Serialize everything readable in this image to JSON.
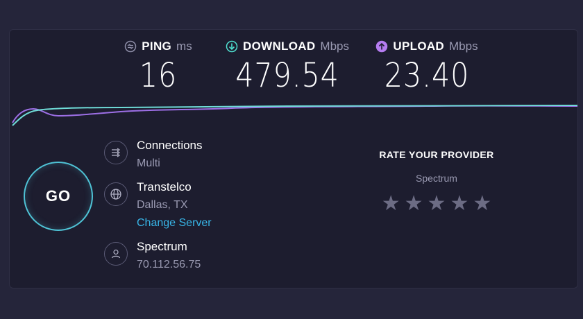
{
  "metrics": {
    "ping": {
      "label": "PING",
      "unit": "ms",
      "value": "16",
      "icon": "ping-icon",
      "color": "#8e8ea8"
    },
    "download": {
      "label": "DOWNLOAD",
      "unit": "Mbps",
      "value": "479.54",
      "icon": "download-arrow-icon",
      "color": "#4fe0d0"
    },
    "upload": {
      "label": "UPLOAD",
      "unit": "Mbps",
      "value": "23.40",
      "icon": "upload-arrow-icon",
      "color": "#b57cf0"
    }
  },
  "go_button": {
    "label": "GO",
    "color": "#4fc3d6"
  },
  "connections": {
    "title": "Connections",
    "value": "Multi",
    "icon": "connections-icon"
  },
  "server": {
    "title": "Transtelco",
    "location": "Dallas, TX",
    "change_label": "Change Server",
    "icon": "globe-icon"
  },
  "isp": {
    "title": "Spectrum",
    "ip": "70.112.56.75",
    "icon": "user-icon"
  },
  "rating": {
    "title": "RATE YOUR PROVIDER",
    "provider": "Spectrum",
    "stars": 5,
    "selected": 0
  },
  "colors": {
    "background": "#25253a",
    "panel": "#1d1d2f",
    "link": "#38b6e8"
  }
}
